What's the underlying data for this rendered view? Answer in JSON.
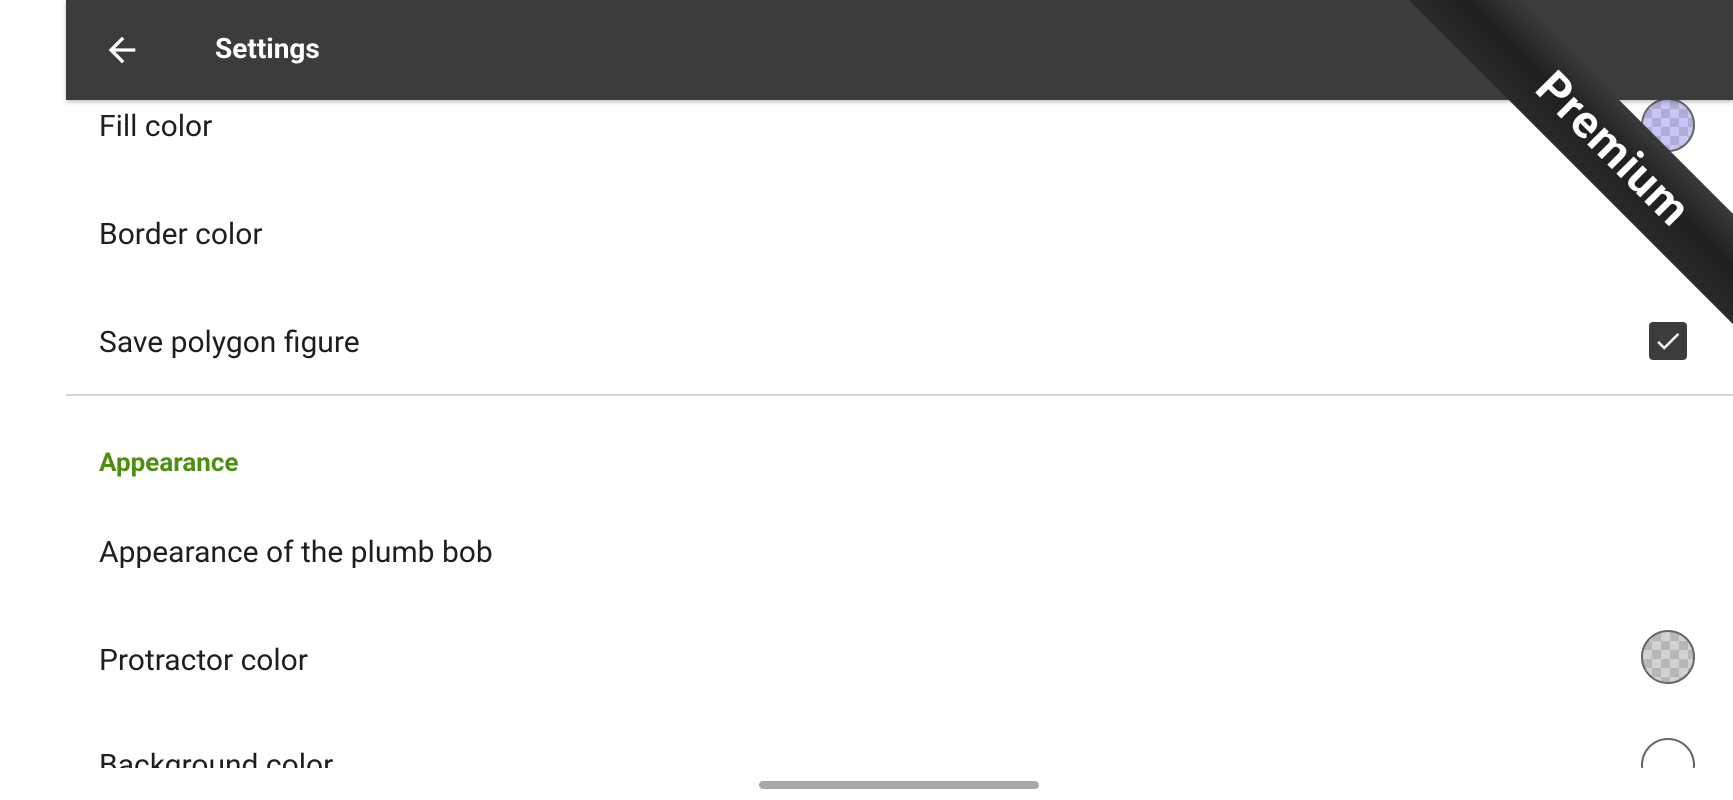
{
  "appbar": {
    "title": "Settings",
    "back_icon": "arrow-left-icon"
  },
  "ribbon": {
    "label": "Premium"
  },
  "settings": {
    "fill_color": {
      "label": "Fill color",
      "swatch_color": "#c9c5f5"
    },
    "border_color": {
      "label": "Border color"
    },
    "save_polygon": {
      "label": "Save polygon figure",
      "checked": true
    },
    "appearance_section": {
      "label": "Appearance"
    },
    "plumb_bob": {
      "label": "Appearance of the plumb bob"
    },
    "protractor_color": {
      "label": "Protractor color",
      "swatch_color": "#d2d2d2"
    },
    "background_color": {
      "label": "Background color",
      "swatch_color": "#ffffff"
    }
  },
  "colors": {
    "appbar": "#3c3c3c",
    "accent_green": "#4e8f12"
  }
}
